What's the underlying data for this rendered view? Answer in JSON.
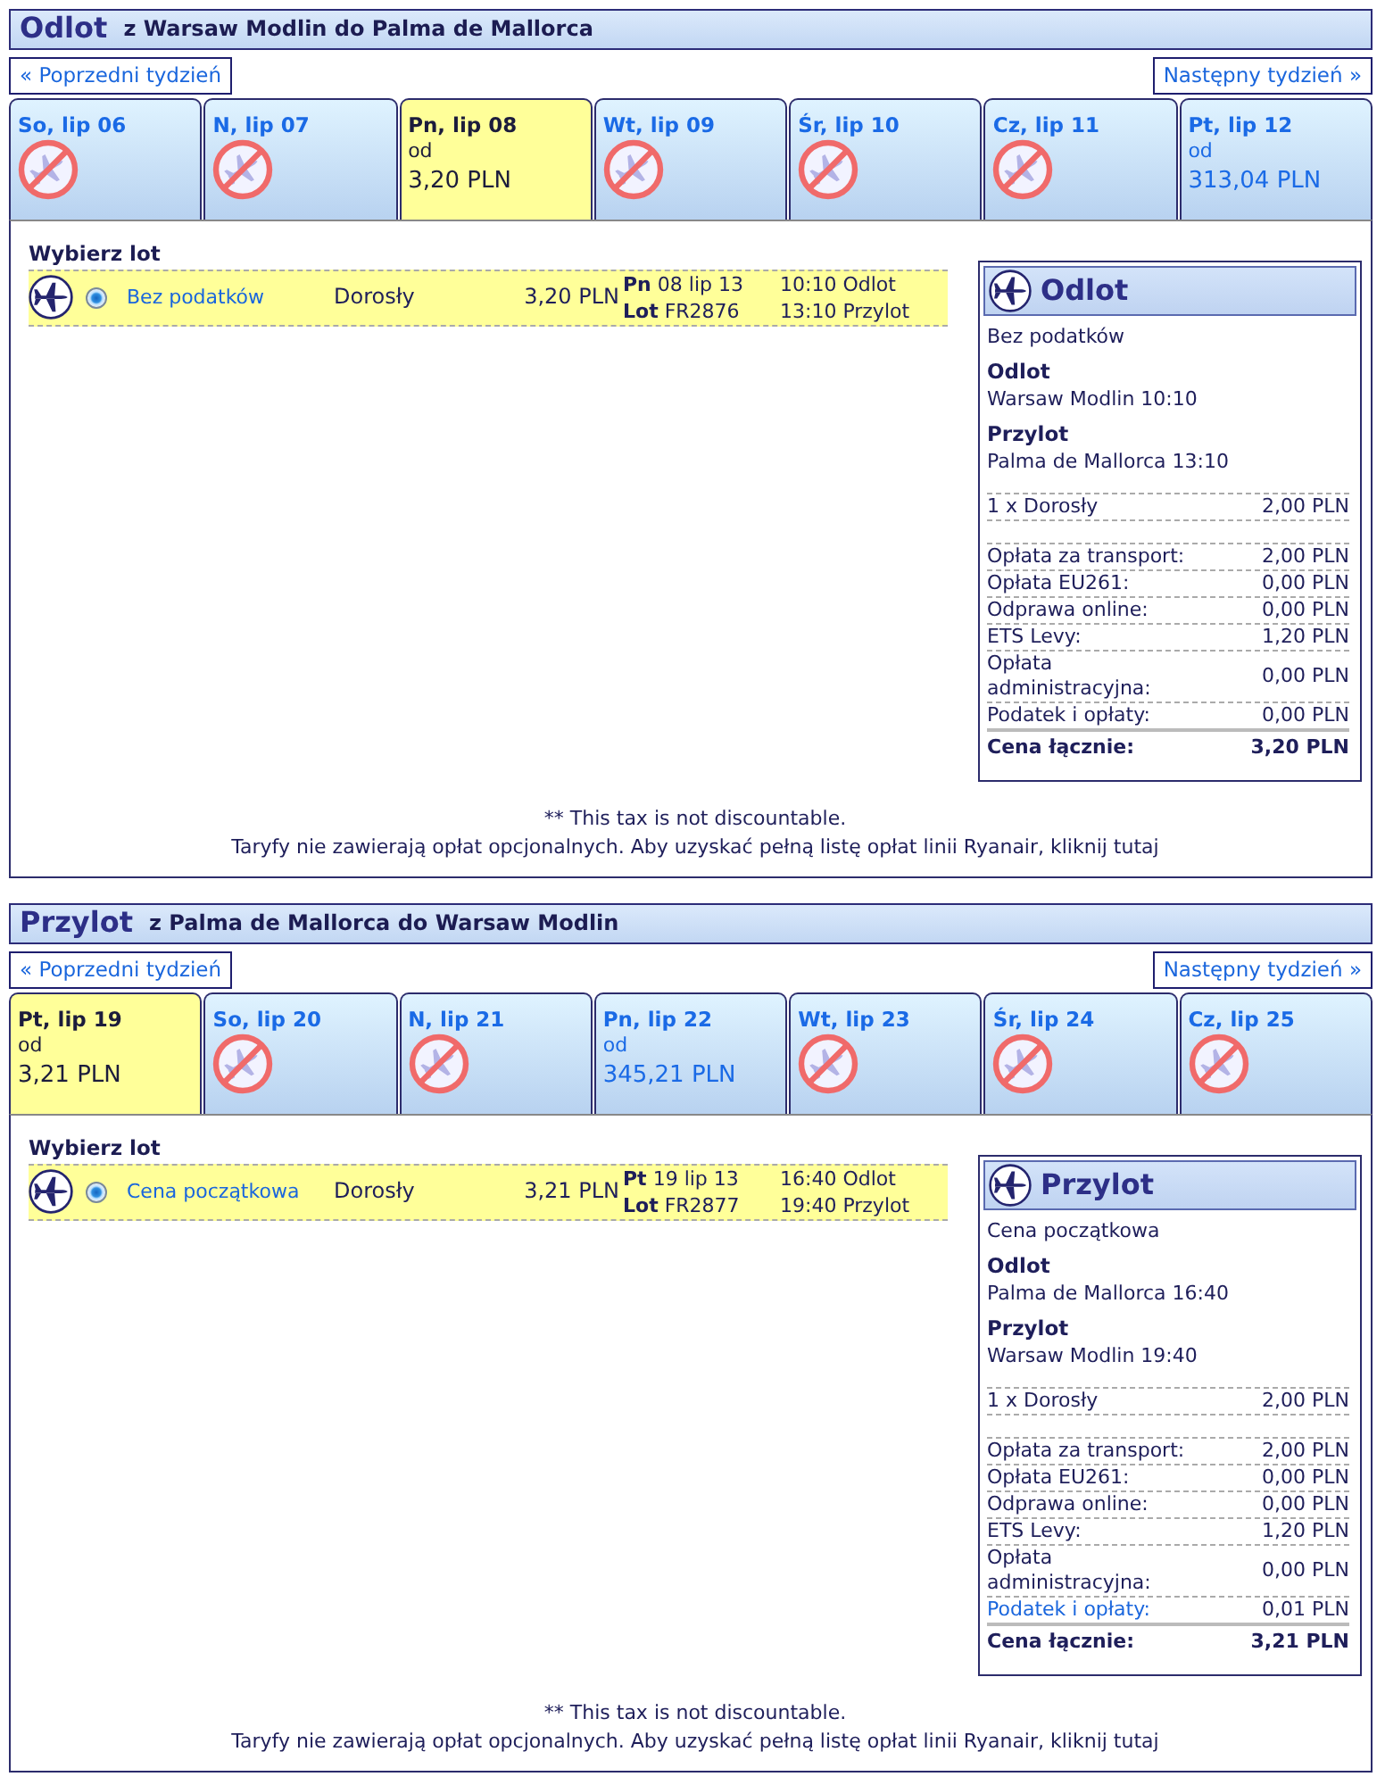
{
  "legs": [
    {
      "title": "Odlot",
      "route": "z Warsaw Modlin do Palma de Mallorca",
      "prev_week": "« Poprzedni tydzień",
      "next_week": "Następny tydzień »",
      "days": [
        {
          "label": "So, lip 06",
          "selected": false,
          "kind": "none"
        },
        {
          "label": "N, lip 07",
          "selected": false,
          "kind": "none"
        },
        {
          "label": "Pn, lip 08",
          "selected": true,
          "kind": "fare",
          "from": "od",
          "price": "3,20 PLN"
        },
        {
          "label": "Wt, lip 09",
          "selected": false,
          "kind": "none"
        },
        {
          "label": "Śr, lip 10",
          "selected": false,
          "kind": "none"
        },
        {
          "label": "Cz, lip 11",
          "selected": false,
          "kind": "none"
        },
        {
          "label": "Pt, lip 12",
          "selected": false,
          "kind": "fare",
          "from": "od",
          "price": "313,04 PLN"
        }
      ],
      "select_heading": "Wybierz lot",
      "flights": [
        {
          "selected": true,
          "fare": "Bez podatków",
          "passenger": "Dorosły",
          "price": "3,20 PLN",
          "date": "**Pn** 08 lip 13",
          "flight": "**Lot** FR2876",
          "departure": "10:10 Odlot",
          "arrival": "13:10 Przylot"
        }
      ],
      "summary": {
        "title": "Odlot",
        "fare": "Bez podatków",
        "departure_heading": "Odlot",
        "departure": "Warsaw Modlin 10:10",
        "arrival_heading": "Przylot",
        "arrival": "Palma de Mallorca 13:10",
        "passengers": [
          {
            "label": "1 x Dorosły",
            "amount": "2,00 PLN"
          }
        ],
        "fees": [
          {
            "label": "Opłata za transport:",
            "amount": "2,00 PLN",
            "kind": "text"
          },
          {
            "label": "Opłata EU261:",
            "amount": "0,00 PLN",
            "kind": "text"
          },
          {
            "label": "Odprawa online:",
            "amount": "0,00 PLN",
            "kind": "text"
          },
          {
            "label": "ETS Levy:",
            "amount": "1,20 PLN",
            "kind": "text"
          },
          {
            "label": "Opłata administracyjna:",
            "amount": "0,00 PLN",
            "kind": "text"
          },
          {
            "label": "Podatek i opłaty:",
            "amount": "0,00 PLN",
            "kind": "text"
          }
        ],
        "total": {
          "label": "Cena łącznie:",
          "amount": "3,20 PLN"
        }
      },
      "footnote": "** This tax is not discountable.",
      "fees_note": "Taryfy nie zawierają opłat opcjonalnych. Aby uzyskać pełną listę opłat linii Ryanair, kliknij tutaj"
    },
    {
      "title": "Przylot",
      "route": "z Palma de Mallorca do Warsaw Modlin",
      "prev_week": "« Poprzedni tydzień",
      "next_week": "Następny tydzień »",
      "days": [
        {
          "label": "Pt, lip 19",
          "selected": true,
          "kind": "fare",
          "from": "od",
          "price": "3,21 PLN"
        },
        {
          "label": "So, lip 20",
          "selected": false,
          "kind": "none"
        },
        {
          "label": "N, lip 21",
          "selected": false,
          "kind": "none"
        },
        {
          "label": "Pn, lip 22",
          "selected": false,
          "kind": "fare",
          "from": "od",
          "price": "345,21 PLN"
        },
        {
          "label": "Wt, lip 23",
          "selected": false,
          "kind": "none"
        },
        {
          "label": "Śr, lip 24",
          "selected": false,
          "kind": "none"
        },
        {
          "label": "Cz, lip 25",
          "selected": false,
          "kind": "none"
        }
      ],
      "select_heading": "Wybierz lot",
      "flights": [
        {
          "selected": true,
          "fare": "Cena początkowa",
          "passenger": "Dorosły",
          "price": "3,21 PLN",
          "date": "**Pt** 19 lip 13",
          "flight": "**Lot** FR2877",
          "departure": "16:40 Odlot",
          "arrival": "19:40 Przylot"
        }
      ],
      "summary": {
        "title": "Przylot",
        "fare": "Cena początkowa",
        "departure_heading": "Odlot",
        "departure": "Palma de Mallorca 16:40",
        "arrival_heading": "Przylot",
        "arrival": "Warsaw Modlin 19:40",
        "passengers": [
          {
            "label": "1 x Dorosły",
            "amount": "2,00 PLN"
          }
        ],
        "fees": [
          {
            "label": "Opłata za transport:",
            "amount": "2,00 PLN",
            "kind": "text"
          },
          {
            "label": "Opłata EU261:",
            "amount": "0,00 PLN",
            "kind": "text"
          },
          {
            "label": "Odprawa online:",
            "amount": "0,00 PLN",
            "kind": "text"
          },
          {
            "label": "ETS Levy:",
            "amount": "1,20 PLN",
            "kind": "text"
          },
          {
            "label": "Opłata administracyjna:",
            "amount": "0,00 PLN",
            "kind": "text"
          },
          {
            "label": "Podatek i opłaty:",
            "amount": "0,01 PLN",
            "kind": "link"
          }
        ],
        "total": {
          "label": "Cena łącznie:",
          "amount": "3,21 PLN"
        }
      },
      "footnote": "** This tax is not discountable.",
      "fees_note": "Taryfy nie zawierają opłat opcjonalnych. Aby uzyskać pełną listę opłat linii Ryanair, kliknij tutaj"
    }
  ]
}
